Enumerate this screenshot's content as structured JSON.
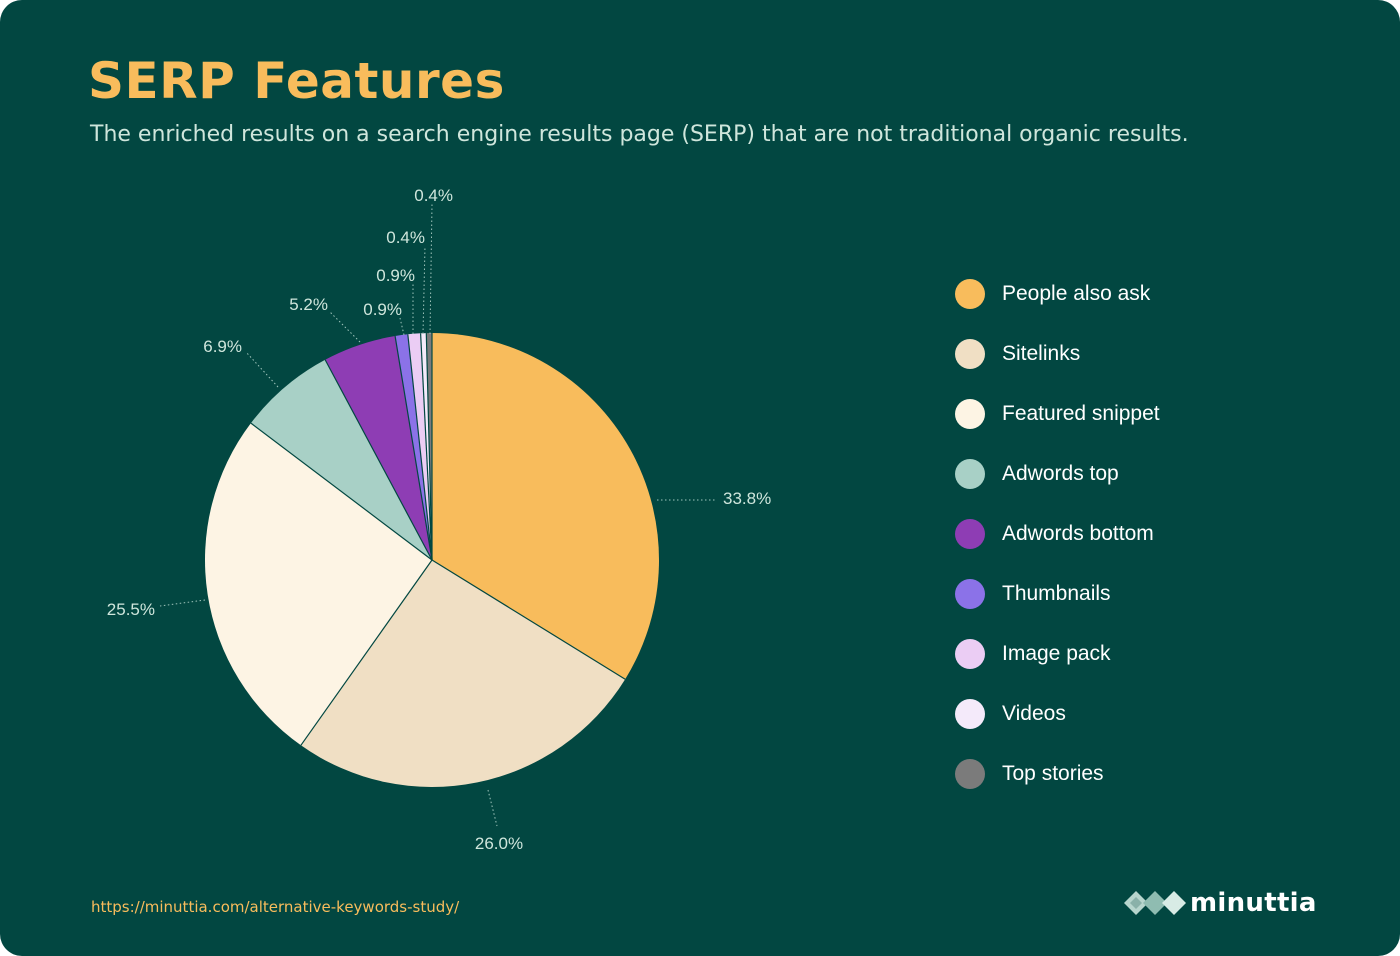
{
  "header": {
    "title": "SERP Features",
    "subtitle": "The enriched results on a search engine results page (SERP) that are not traditional organic results."
  },
  "chart_data": {
    "type": "pie",
    "title": "SERP Features",
    "slices": [
      {
        "label": "People also ask",
        "value": 33.8,
        "display": "33.8%",
        "color": "#f8bc5c"
      },
      {
        "label": "Sitelinks",
        "value": 26.0,
        "display": "26.0%",
        "color": "#f0dfc4"
      },
      {
        "label": "Featured snippet",
        "value": 25.5,
        "display": "25.5%",
        "color": "#fdf4e4"
      },
      {
        "label": "Adwords top",
        "value": 6.9,
        "display": "6.9%",
        "color": "#a8d0c6"
      },
      {
        "label": "Adwords bottom",
        "value": 5.2,
        "display": "5.2%",
        "color": "#8e3db4"
      },
      {
        "label": "Thumbnails",
        "value": 0.9,
        "display": "0.9%",
        "color": "#8b72e8"
      },
      {
        "label": "Image pack",
        "value": 0.9,
        "display": "0.9%",
        "color": "#ebcdf4"
      },
      {
        "label": "Videos",
        "value": 0.4,
        "display": "0.4%",
        "color": "#f4eafa"
      },
      {
        "label": "Top stories",
        "value": 0.4,
        "display": "0.4%",
        "color": "#7b7b7b"
      }
    ],
    "legend_position": "right",
    "start_angle": "top",
    "direction": "clockwise"
  },
  "footer": {
    "source_url": "https://minuttia.com/alternative-keywords-study/",
    "brand_name": "minuttia"
  },
  "colors": {
    "background": "#024741",
    "accent": "#f8bc5c",
    "subtitle": "#cfe6dc",
    "label": "#cfe6dc",
    "leader_line": "#9fc4bb"
  }
}
